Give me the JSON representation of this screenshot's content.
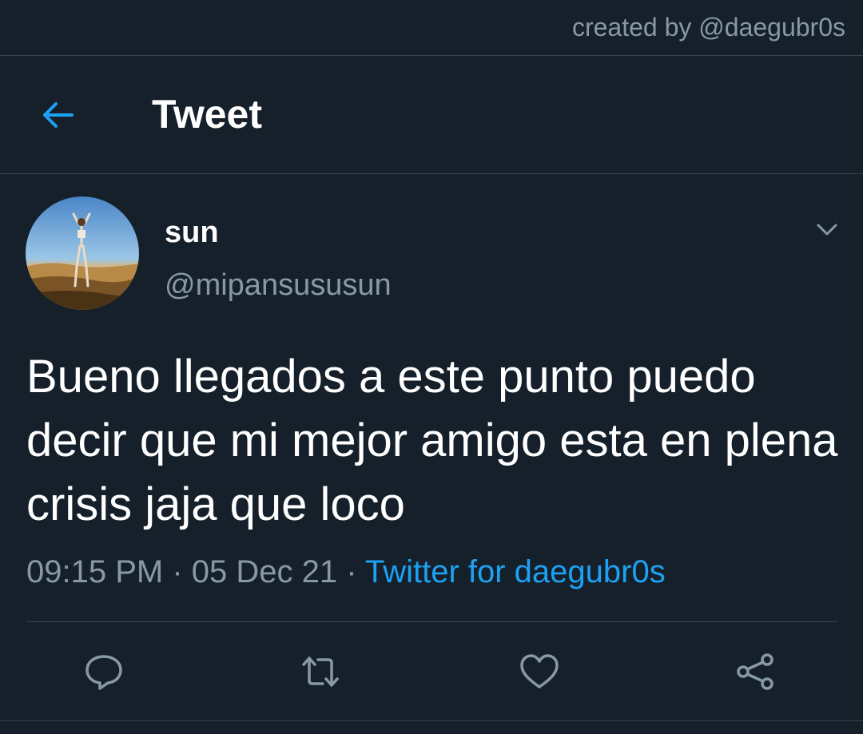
{
  "watermark": {
    "text": "created by @daegubr0s"
  },
  "header": {
    "title": "Tweet",
    "back_icon": "arrow-left-icon"
  },
  "tweet": {
    "author": {
      "display_name": "sun",
      "handle": "@mipansususun"
    },
    "text": "Bueno llegados a este punto puedo decir que mi mejor amigo esta en plena crisis jaja que loco",
    "time": "09:15 PM",
    "separator": "·",
    "date": "05 Dec 21",
    "source": "Twitter for daegubr0s",
    "menu_icon": "chevron-down-icon"
  },
  "actions": [
    {
      "name": "reply",
      "icon": "reply-icon"
    },
    {
      "name": "retweet",
      "icon": "retweet-icon"
    },
    {
      "name": "like",
      "icon": "heart-icon"
    },
    {
      "name": "share",
      "icon": "share-icon"
    }
  ],
  "colors": {
    "background": "#15202b",
    "accent": "#1da1f2",
    "secondary_text": "#8899a6",
    "border": "#38444d"
  }
}
